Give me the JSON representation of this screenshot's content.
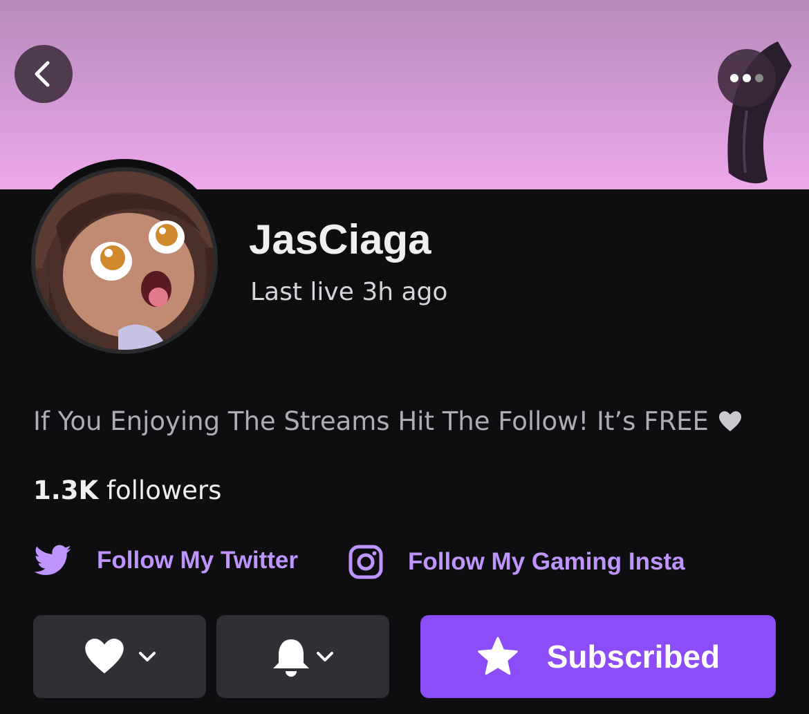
{
  "header": {
    "back_icon": "chevron-left-icon",
    "more_icon": "more-options-icon"
  },
  "profile": {
    "channel_name": "JasCiaga",
    "status": "Last live 3h ago",
    "bio": "If You Enjoying The Streams Hit The Follow! It’s FREE",
    "bio_icon": "heart-icon",
    "followers_count": "1.3K",
    "followers_label": "followers"
  },
  "links": [
    {
      "label": "Follow My Twitter",
      "icon": "twitter-icon"
    },
    {
      "label": "Follow My Gaming Insta",
      "icon": "instagram-icon"
    }
  ],
  "actions": {
    "follow_icon": "heart-icon",
    "notify_icon": "bell-icon",
    "subscribe_label": "Subscribed",
    "subscribe_icon": "star-icon"
  },
  "colors": {
    "accent": "#8a4df7",
    "link": "#bf94ff",
    "background": "#0e0e10",
    "banner": "#d39ad6"
  }
}
